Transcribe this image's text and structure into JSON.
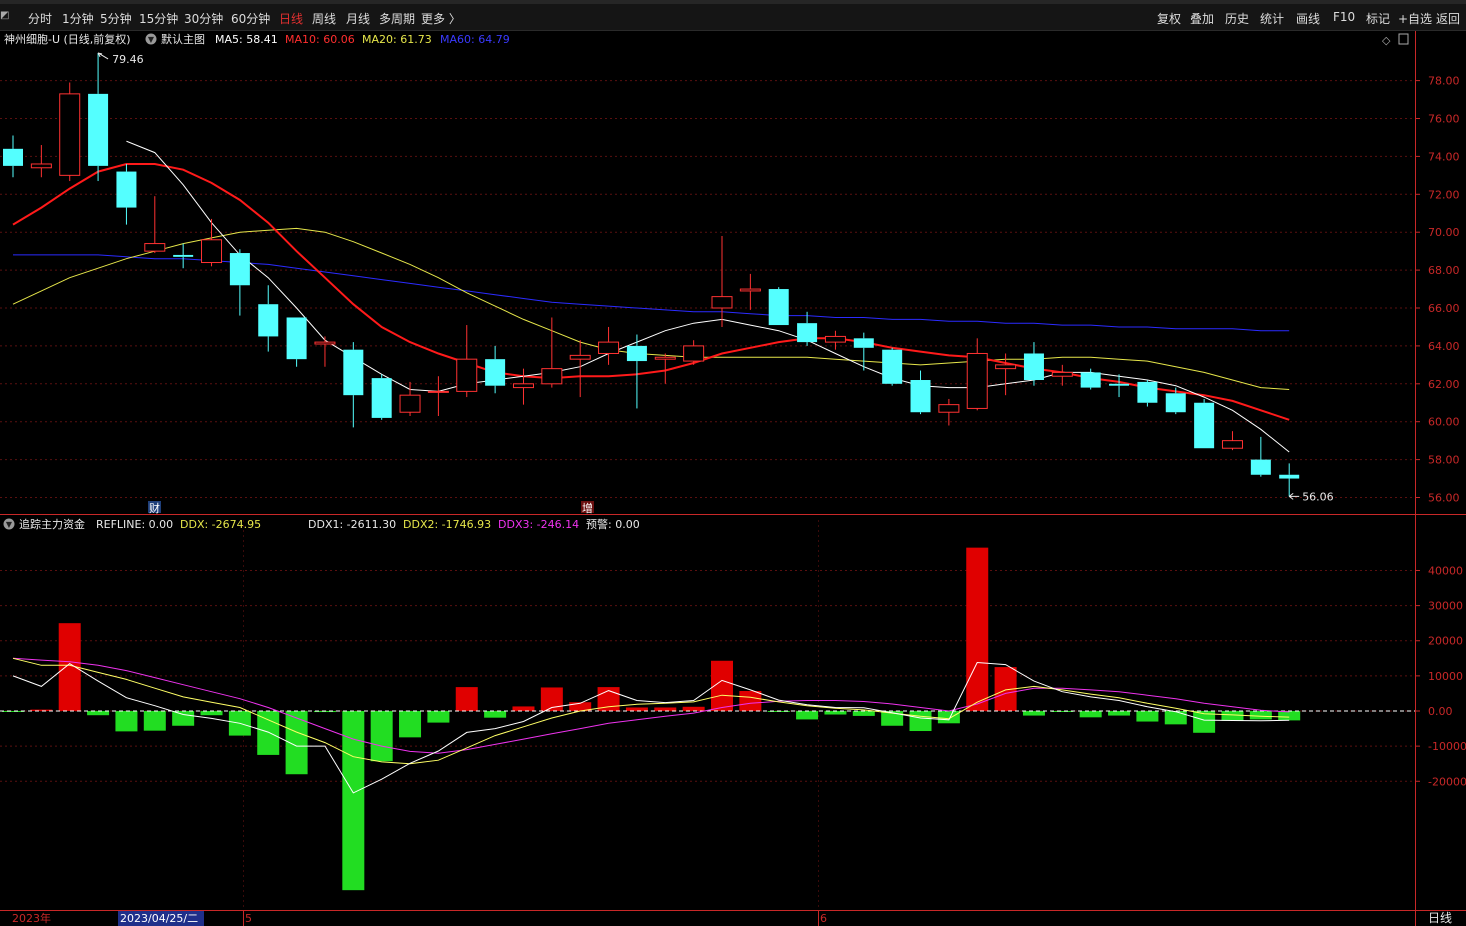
{
  "toolbar": {
    "periods": [
      "分时",
      "1分钟",
      "5分钟",
      "15分钟",
      "30分钟",
      "60分钟",
      "日线",
      "周线",
      "月线",
      "多周期",
      "更多 〉"
    ],
    "active_period": "日线",
    "right_buttons": [
      "复权",
      "叠加",
      "历史",
      "统计",
      "画线",
      "F10",
      "标记",
      "+自选",
      "返回"
    ]
  },
  "main_panel": {
    "title": "神州细胞-U (日线,前复权)",
    "indicator_label": "默认主图",
    "ma5": "MA5: 58.41",
    "ma10": "MA10: 60.06",
    "ma20": "MA20: 61.73",
    "ma60": "MA60: 64.79",
    "high_label": "79.46",
    "low_label": "56.06",
    "event_marker_1": "财",
    "event_marker_2": "增",
    "y_ticks": [
      "78.00",
      "76.00",
      "74.00",
      "72.00",
      "70.00",
      "68.00",
      "66.00",
      "64.00",
      "62.00",
      "60.00",
      "58.00",
      "56.00"
    ]
  },
  "sub_panel": {
    "title": "追踪主力资金",
    "refline": "REFLINE: 0.00",
    "ddx": "DDX: -2674.95",
    "ddx1": "DDX1: -2611.30",
    "ddx2": "DDX2: -1746.93",
    "ddx3": "DDX3: -246.14",
    "alert": "预警: 0.00",
    "y_ticks": [
      "40000",
      "30000",
      "20000",
      "10000",
      "0.00",
      "-10000",
      "-20000"
    ]
  },
  "x_axis": {
    "year_label": "2023年",
    "cursor_date": "2023/04/25/二",
    "month_5": "5",
    "month_6": "6",
    "period_label": "日线"
  },
  "colors": {
    "up": "#ff3232",
    "down": "#54ffff",
    "ma5": "#ffffff",
    "ma10": "#ff1a1a",
    "ma20": "#e6e64a",
    "ma60": "#2b2bff",
    "ddx_pos": "#e00000",
    "ddx_neg": "#22dd22",
    "ddx2": "#ffff66",
    "ddx3": "#ee33ee",
    "axis": "#c82828"
  },
  "chart_data": {
    "type": "candlestick",
    "candles": [
      {
        "o": 74.4,
        "h": 75.1,
        "l": 72.9,
        "c": 73.5
      },
      {
        "o": 73.4,
        "h": 74.6,
        "l": 72.9,
        "c": 73.6
      },
      {
        "o": 73.0,
        "h": 77.9,
        "l": 72.7,
        "c": 77.3
      },
      {
        "o": 77.3,
        "h": 79.46,
        "l": 72.7,
        "c": 73.5
      },
      {
        "o": 73.2,
        "h": 73.6,
        "l": 70.4,
        "c": 71.3
      },
      {
        "o": 69.0,
        "h": 71.9,
        "l": 68.9,
        "c": 69.4
      },
      {
        "o": 68.8,
        "h": 69.4,
        "l": 68.1,
        "c": 68.7
      },
      {
        "o": 68.4,
        "h": 70.7,
        "l": 68.2,
        "c": 69.6
      },
      {
        "o": 68.9,
        "h": 69.1,
        "l": 65.6,
        "c": 67.2
      },
      {
        "o": 66.2,
        "h": 67.2,
        "l": 63.7,
        "c": 64.5
      },
      {
        "o": 65.5,
        "h": 65.5,
        "l": 62.9,
        "c": 63.3
      },
      {
        "o": 64.1,
        "h": 64.5,
        "l": 62.9,
        "c": 64.2
      },
      {
        "o": 63.8,
        "h": 64.2,
        "l": 59.7,
        "c": 61.4
      },
      {
        "o": 62.3,
        "h": 62.5,
        "l": 60.1,
        "c": 60.2
      },
      {
        "o": 60.5,
        "h": 62.1,
        "l": 60.3,
        "c": 61.4
      },
      {
        "o": 61.6,
        "h": 62.4,
        "l": 60.3,
        "c": 61.6
      },
      {
        "o": 61.6,
        "h": 65.1,
        "l": 61.3,
        "c": 63.3
      },
      {
        "o": 63.3,
        "h": 64.0,
        "l": 61.5,
        "c": 61.9
      },
      {
        "o": 61.8,
        "h": 62.8,
        "l": 60.9,
        "c": 62.0
      },
      {
        "o": 62.0,
        "h": 65.5,
        "l": 61.8,
        "c": 62.8
      },
      {
        "o": 63.3,
        "h": 64.3,
        "l": 61.3,
        "c": 63.5
      },
      {
        "o": 63.6,
        "h": 65.0,
        "l": 63.0,
        "c": 64.2
      },
      {
        "o": 64.0,
        "h": 64.6,
        "l": 60.7,
        "c": 63.2
      },
      {
        "o": 63.3,
        "h": 63.6,
        "l": 62.0,
        "c": 63.4
      },
      {
        "o": 63.2,
        "h": 64.3,
        "l": 63.0,
        "c": 64.0
      },
      {
        "o": 66.0,
        "h": 69.8,
        "l": 65.0,
        "c": 66.6
      },
      {
        "o": 66.9,
        "h": 67.8,
        "l": 65.9,
        "c": 67.0
      },
      {
        "o": 67.0,
        "h": 67.1,
        "l": 65.1,
        "c": 65.1
      },
      {
        "o": 65.2,
        "h": 65.8,
        "l": 64.0,
        "c": 64.2
      },
      {
        "o": 64.2,
        "h": 64.8,
        "l": 63.8,
        "c": 64.5
      },
      {
        "o": 64.4,
        "h": 64.7,
        "l": 62.7,
        "c": 63.9
      },
      {
        "o": 63.8,
        "h": 63.9,
        "l": 61.9,
        "c": 62.0
      },
      {
        "o": 62.2,
        "h": 62.7,
        "l": 60.4,
        "c": 60.5
      },
      {
        "o": 60.5,
        "h": 61.2,
        "l": 59.8,
        "c": 60.9
      },
      {
        "o": 60.7,
        "h": 64.4,
        "l": 60.6,
        "c": 63.6
      },
      {
        "o": 62.8,
        "h": 63.6,
        "l": 61.4,
        "c": 63.0
      },
      {
        "o": 63.6,
        "h": 64.2,
        "l": 61.9,
        "c": 62.2
      },
      {
        "o": 62.4,
        "h": 63.0,
        "l": 61.9,
        "c": 62.6
      },
      {
        "o": 62.6,
        "h": 62.8,
        "l": 61.7,
        "c": 61.8
      },
      {
        "o": 62.0,
        "h": 62.5,
        "l": 61.3,
        "c": 61.9
      },
      {
        "o": 62.1,
        "h": 62.2,
        "l": 60.8,
        "c": 61.0
      },
      {
        "o": 61.5,
        "h": 61.8,
        "l": 60.4,
        "c": 60.5
      },
      {
        "o": 61.0,
        "h": 61.2,
        "l": 58.6,
        "c": 58.6
      },
      {
        "o": 58.6,
        "h": 59.5,
        "l": 58.5,
        "c": 59.0
      },
      {
        "o": 58.0,
        "h": 59.2,
        "l": 57.1,
        "c": 57.2
      },
      {
        "o": 57.2,
        "h": 57.8,
        "l": 56.06,
        "c": 57.0
      }
    ],
    "ma5": [
      null,
      null,
      null,
      null,
      74.8,
      74.2,
      72.5,
      70.5,
      68.8,
      67.6,
      66.0,
      64.3,
      63.4,
      62.5,
      61.7,
      61.6,
      62.0,
      62.2,
      62.4,
      62.6,
      62.9,
      63.6,
      64.2,
      64.8,
      65.2,
      65.4,
      65.1,
      64.8,
      64.3,
      63.6,
      62.9,
      62.3,
      61.9,
      61.8,
      61.8,
      62.0,
      62.2,
      62.6,
      62.6,
      62.4,
      62.2,
      61.9,
      61.3,
      60.6,
      59.6,
      58.4
    ],
    "ma10": [
      70.4,
      71.3,
      72.3,
      73.2,
      73.6,
      73.6,
      73.3,
      72.6,
      71.7,
      70.5,
      69.0,
      67.6,
      66.2,
      65.0,
      64.2,
      63.6,
      63.1,
      62.6,
      62.4,
      62.3,
      62.4,
      62.4,
      62.5,
      62.7,
      63.1,
      63.6,
      63.9,
      64.2,
      64.4,
      64.4,
      64.2,
      63.9,
      63.7,
      63.5,
      63.4,
      63.1,
      62.8,
      62.6,
      62.3,
      62.1,
      61.8,
      61.6,
      61.4,
      61.1,
      60.6,
      60.1
    ],
    "ma20": [
      66.2,
      66.9,
      67.6,
      68.1,
      68.6,
      69.0,
      69.4,
      69.7,
      70.0,
      70.1,
      70.2,
      70.0,
      69.5,
      68.9,
      68.3,
      67.6,
      66.8,
      66.1,
      65.4,
      64.8,
      64.2,
      63.8,
      63.6,
      63.5,
      63.4,
      63.4,
      63.4,
      63.4,
      63.4,
      63.3,
      63.2,
      63.1,
      63.0,
      63.1,
      63.2,
      63.3,
      63.3,
      63.4,
      63.4,
      63.3,
      63.2,
      62.9,
      62.6,
      62.2,
      61.8,
      61.7
    ],
    "ma60": [
      68.8,
      68.8,
      68.8,
      68.8,
      68.7,
      68.6,
      68.6,
      68.5,
      68.4,
      68.3,
      68.1,
      67.9,
      67.7,
      67.5,
      67.3,
      67.1,
      66.9,
      66.7,
      66.5,
      66.3,
      66.2,
      66.1,
      66.0,
      65.9,
      65.8,
      65.8,
      65.7,
      65.6,
      65.6,
      65.5,
      65.5,
      65.4,
      65.4,
      65.3,
      65.3,
      65.2,
      65.2,
      65.1,
      65.1,
      65.0,
      65.0,
      64.9,
      64.9,
      64.9,
      64.8,
      64.8
    ],
    "ddx": [
      -200,
      400,
      25000,
      -1200,
      -5800,
      -5600,
      -4200,
      -1200,
      -7000,
      -12500,
      -18000,
      -300,
      -51000,
      -14300,
      -7500,
      -3300,
      6800,
      -1900,
      1300,
      6700,
      2500,
      6800,
      1000,
      1000,
      1200,
      14300,
      5700,
      -200,
      -2400,
      -1000,
      -1400,
      -4200,
      -5700,
      -3500,
      46500,
      12500,
      -1300,
      -200,
      -1800,
      -1300,
      -3000,
      -3800,
      -6200,
      -2800,
      -2400,
      -2675
    ],
    "ddx1": [
      10000,
      7000,
      13500,
      8500,
      3800,
      1500,
      -1000,
      -2100,
      -3500,
      -6000,
      -10000,
      -10000,
      -23300,
      -19400,
      -14900,
      -11400,
      -6100,
      -5000,
      -3000,
      1000,
      2200,
      5800,
      3000,
      2400,
      3000,
      8700,
      6000,
      3100,
      1800,
      1000,
      900,
      -500,
      -2000,
      -2500,
      13800,
      13200,
      8500,
      5500,
      4000,
      3000,
      1200,
      -200,
      -2600,
      -2700,
      -2800,
      -2611
    ],
    "ddx2": [
      15000,
      13000,
      13000,
      11000,
      9000,
      6500,
      4000,
      2500,
      1000,
      -2500,
      -6000,
      -9000,
      -13000,
      -14500,
      -15000,
      -14000,
      -10500,
      -7000,
      -4500,
      -2000,
      0,
      1200,
      1900,
      2200,
      2600,
      4500,
      3900,
      2600,
      1500,
      800,
      300,
      -600,
      -1500,
      -2200,
      2500,
      6000,
      7000,
      6000,
      4800,
      3800,
      2200,
      800,
      -800,
      -1100,
      -1500,
      -1747
    ],
    "ddx3": [
      15000,
      14500,
      14000,
      13000,
      11500,
      9500,
      7500,
      5500,
      3500,
      1000,
      -2000,
      -5000,
      -8000,
      -10000,
      -11500,
      -12000,
      -11000,
      -9500,
      -8000,
      -6500,
      -5000,
      -3500,
      -2500,
      -1500,
      -600,
      1000,
      2200,
      2800,
      3000,
      3000,
      2700,
      2000,
      1000,
      0,
      2000,
      5000,
      6500,
      6500,
      6000,
      5500,
      4500,
      3500,
      2200,
      1200,
      200,
      -246
    ]
  }
}
